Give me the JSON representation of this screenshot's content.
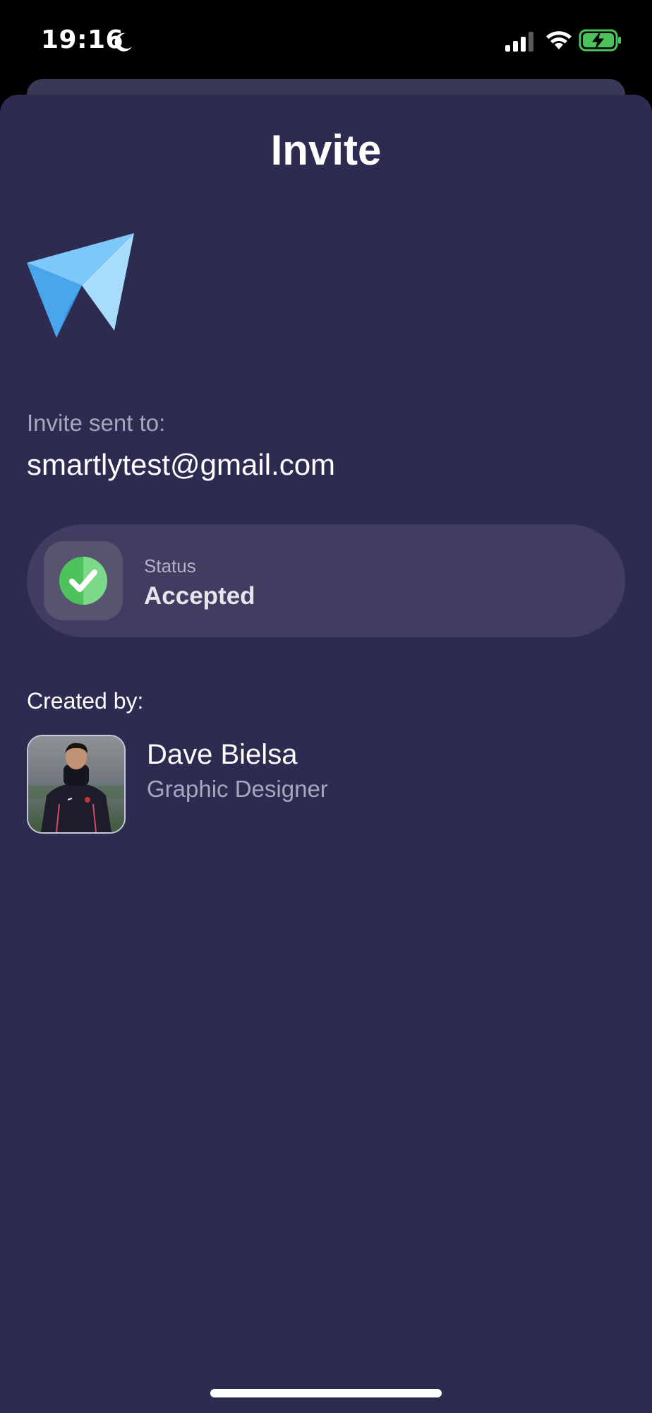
{
  "status_bar": {
    "time": "19:16",
    "icons": [
      "moon-icon",
      "signal-icon",
      "wifi-icon",
      "battery-charging-icon"
    ]
  },
  "colors": {
    "sheet_background": "#2e2b50",
    "card_background": "#403d60",
    "accent_green": "#4cc35b",
    "plane_blue": "#5bb8f5",
    "secondary_text": "#a8a6bf"
  },
  "header": {
    "title": "Invite"
  },
  "invite": {
    "icon": "paper-plane-icon",
    "sent_label": "Invite sent to:",
    "email": "smartlytest@gmail.com"
  },
  "status": {
    "icon": "check-circle-icon",
    "label": "Status",
    "value": "Accepted"
  },
  "creator": {
    "label": "Created by:",
    "name": "Dave Bielsa",
    "role": "Graphic Designer"
  }
}
